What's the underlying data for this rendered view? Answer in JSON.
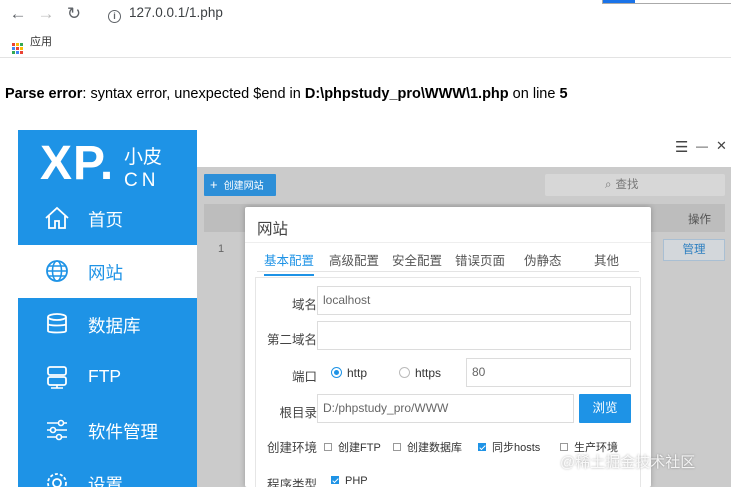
{
  "browser": {
    "url": "127.0.0.1/1.php",
    "bookmark_label": "应用",
    "back_icon": "back-arrow-icon",
    "forward_icon": "forward-arrow-icon",
    "reload_icon": "reload-icon",
    "info_glyph": "i"
  },
  "error": {
    "label": "Parse error",
    "message": ": syntax error, unexpected $end in ",
    "path": "D:\\phpstudy_pro\\WWW\\1.php",
    "on_line": " on line ",
    "line": "5"
  },
  "app": {
    "logo_main": "XP.",
    "logo_small": "小皮",
    "logo_cn": "CN",
    "sidebar": [
      {
        "label": "首页",
        "icon": "home-icon"
      },
      {
        "label": "网站",
        "icon": "globe-icon",
        "active": true
      },
      {
        "label": "数据库",
        "icon": "database-icon"
      },
      {
        "label": "FTP",
        "icon": "server-icon"
      },
      {
        "label": "软件管理",
        "icon": "sliders-icon"
      },
      {
        "label": "设置",
        "icon": "gear-icon"
      }
    ],
    "window_controls": {
      "menu": "☰",
      "minimize": "—",
      "close": "✕"
    },
    "create_site": "创建网站",
    "search_placeholder": "查找",
    "table": {
      "op_header": "操作",
      "rows": [
        {
          "num": "1",
          "action": "管理"
        }
      ]
    },
    "accent_color": "#1e93e6"
  },
  "dialog": {
    "title": "网站",
    "tabs": [
      "基本配置",
      "高级配置",
      "安全配置",
      "错误页面",
      "伪静态",
      "其他"
    ],
    "fields": {
      "domain_label": "域名",
      "domain_value": "localhost",
      "second_domain_label": "第二域名",
      "second_domain_value": "",
      "port_label": "端口",
      "http": "http",
      "https": "https",
      "port_value": "80",
      "root_label": "根目录",
      "root_value": "D:/phpstudy_pro/WWW",
      "browse": "浏览",
      "env_label": "创建环境",
      "env_options": [
        {
          "label": "创建FTP",
          "checked": false
        },
        {
          "label": "创建数据库",
          "checked": false
        },
        {
          "label": "同步hosts",
          "checked": true
        },
        {
          "label": "生产环境",
          "checked": false
        }
      ],
      "type_label": "程序类型",
      "type_value": "PHP",
      "type_checked": true
    }
  },
  "watermark": "@稀土掘金技术社区"
}
